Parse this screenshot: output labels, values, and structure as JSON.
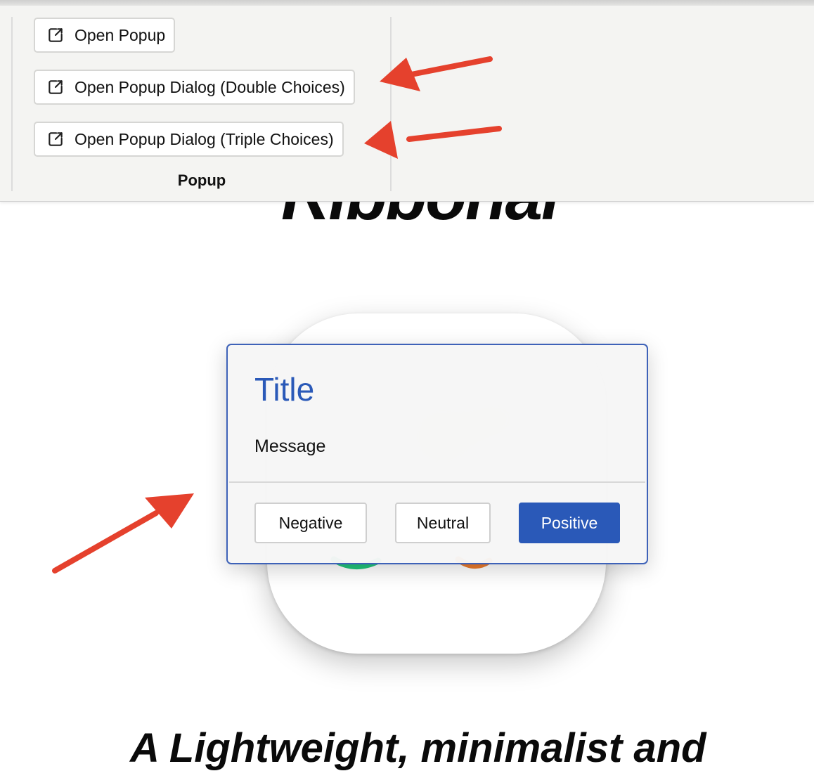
{
  "ribbon": {
    "buttons": [
      {
        "label": "Open Popup",
        "icon": "external-link-icon"
      },
      {
        "label": "Open Popup Dialog (Double Choices)",
        "icon": "external-link-icon"
      },
      {
        "label": "Open Popup Dialog (Triple Choices)",
        "icon": "external-link-icon"
      }
    ],
    "group_label": "Popup"
  },
  "background": {
    "hero_title": "Ribbonal",
    "tagline": "A Lightweight, minimalist and"
  },
  "dialog": {
    "title": "Title",
    "message": "Message",
    "buttons": {
      "negative": "Negative",
      "neutral": "Neutral",
      "positive": "Positive"
    }
  },
  "colors": {
    "accent": "#2a59b8",
    "annotation_arrow": "#e5412d",
    "ribbon_bg": "#f4f4f2"
  }
}
